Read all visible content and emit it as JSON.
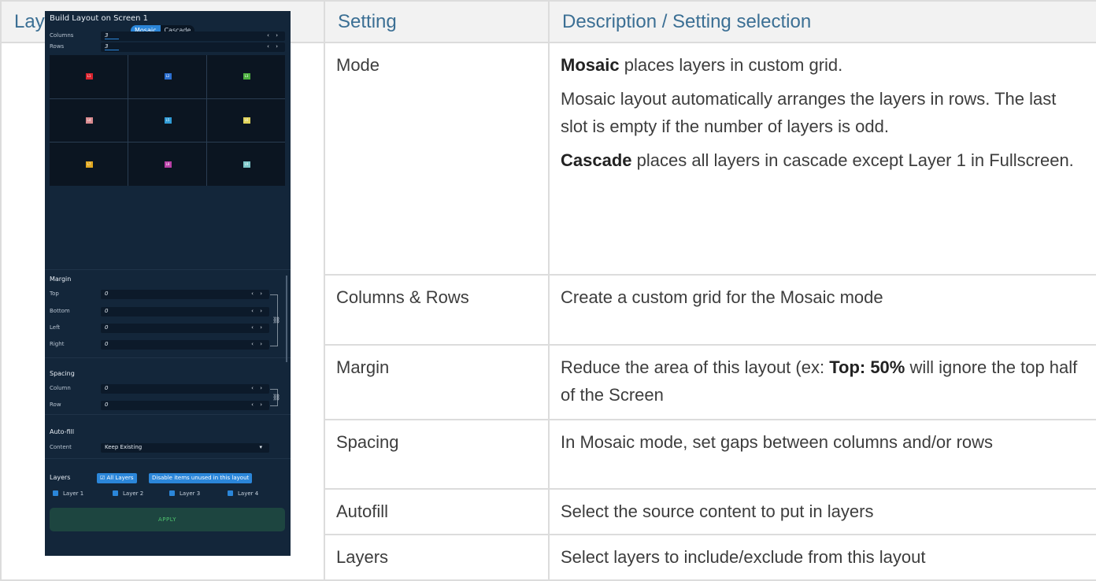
{
  "headers": {
    "col1": "Layout editor view",
    "col2": "Setting",
    "col3": "Description / Setting selection"
  },
  "rows": [
    {
      "setting": "Mode",
      "paragraphs": [
        {
          "bold": "Mosaic",
          "text": " places layers in custom grid."
        },
        {
          "bold": "",
          "text": "Mosaic layout automatically arranges the layers in rows. The last slot is empty if the number of layers is odd."
        },
        {
          "bold": "Cascade",
          "text": " places all layers in cascade except Layer 1 in Fullscreen."
        }
      ]
    },
    {
      "setting": "Columns & Rows",
      "paragraphs": [
        {
          "bold": "",
          "text": "Create a custom grid for the Mosaic mode"
        }
      ]
    },
    {
      "setting": "Margin",
      "paragraphs": [
        {
          "pre": "Reduce the area of this layout (ex: ",
          "bold": "Top: 50%",
          "text": " will ignore the top half of the Screen"
        }
      ]
    },
    {
      "setting": "Spacing",
      "paragraphs": [
        {
          "bold": "",
          "text": "In Mosaic mode, set gaps between columns and/or rows"
        }
      ]
    },
    {
      "setting": "Autofill",
      "paragraphs": [
        {
          "bold": "",
          "text": "Select the source content to put in layers"
        }
      ]
    },
    {
      "setting": "Layers",
      "paragraphs": [
        {
          "bold": "",
          "text": "Select layers to include/exclude from this layout"
        }
      ]
    }
  ],
  "editor": {
    "title": "Build Layout on Screen 1",
    "modes": [
      "Mosaic",
      "Cascade"
    ],
    "active_mode": "Mosaic",
    "columns_label": "Columns",
    "columns_value": "3",
    "rows_label": "Rows",
    "rows_value": "3",
    "arrows": "‹ ›",
    "grid_cells": [
      {
        "label": "L1",
        "color": "#d9232e"
      },
      {
        "label": "L2",
        "color": "#2b6fd1"
      },
      {
        "label": "L3",
        "color": "#4caf3e"
      },
      {
        "label": "L4",
        "color": "#d98a8f"
      },
      {
        "label": "L5",
        "color": "#2f9bd6"
      },
      {
        "label": "L6",
        "color": "#e0d35a"
      },
      {
        "label": "L7",
        "color": "#e0a821"
      },
      {
        "label": "L8",
        "color": "#b83fa6"
      },
      {
        "label": "L9",
        "color": "#7cc6c9"
      }
    ],
    "margin_title": "Margin",
    "margin_fields": [
      {
        "label": "Top",
        "value": "0"
      },
      {
        "label": "Bottom",
        "value": "0"
      },
      {
        "label": "Left",
        "value": "0"
      },
      {
        "label": "Right",
        "value": "0"
      }
    ],
    "spacing_title": "Spacing",
    "spacing_fields": [
      {
        "label": "Column",
        "value": "0"
      },
      {
        "label": "Row",
        "value": "0"
      }
    ],
    "autofill_title": "Auto-fill",
    "content_label": "Content",
    "content_value": "Keep Existing",
    "layers_title": "Layers",
    "all_layers_btn": "All Layers",
    "disable_btn": "Disable items unused in this layout",
    "layers": [
      "Layer 1",
      "Layer 2",
      "Layer 3",
      "Layer 4"
    ],
    "apply_label": "APPLY",
    "accent": "#2b86d9"
  }
}
